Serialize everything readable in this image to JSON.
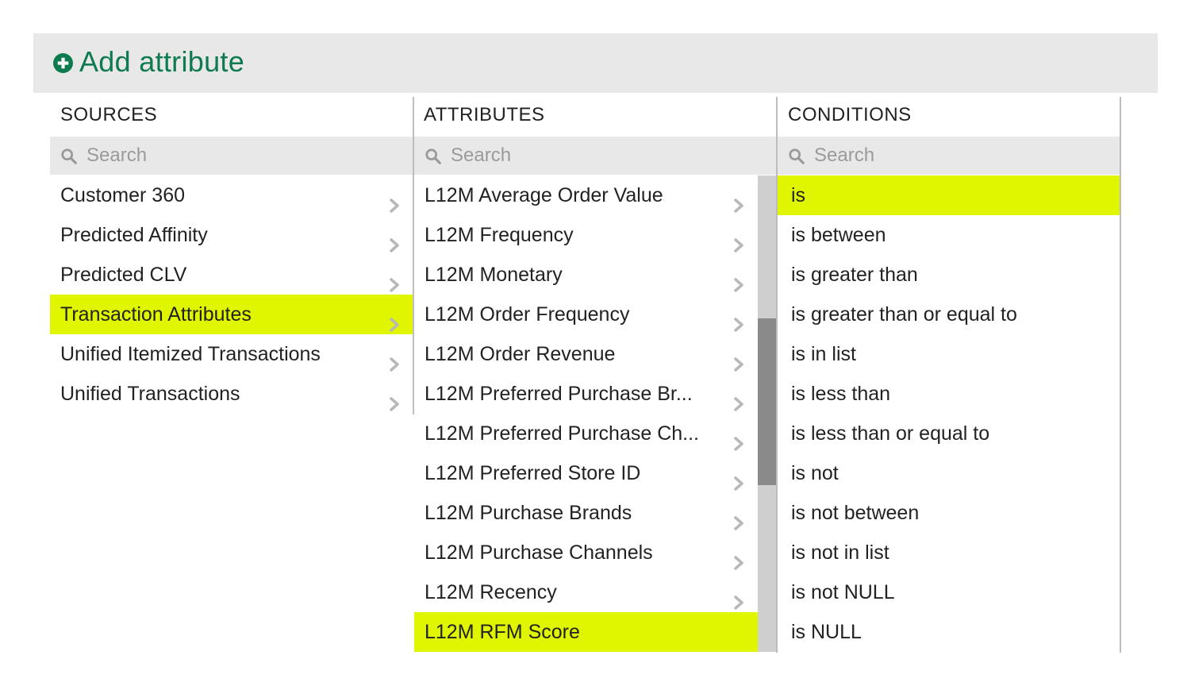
{
  "header": {
    "title": "Add attribute",
    "icon": "plus-circle-icon",
    "color": "#0e7a4f"
  },
  "highlight_color": "#e0f500",
  "columns": {
    "sources": {
      "title": "SOURCES",
      "search_placeholder": "Search",
      "items": [
        {
          "label": "Customer 360",
          "selected": false
        },
        {
          "label": "Predicted Affinity",
          "selected": false
        },
        {
          "label": "Predicted CLV",
          "selected": false
        },
        {
          "label": "Transaction Attributes",
          "selected": true
        },
        {
          "label": "Unified Itemized Transactions",
          "selected": false
        },
        {
          "label": "Unified Transactions",
          "selected": false
        }
      ]
    },
    "attributes": {
      "title": "ATTRIBUTES",
      "search_placeholder": "Search",
      "items": [
        {
          "label": "L12M Average Order Value",
          "selected": false,
          "chevron": true
        },
        {
          "label": "L12M Frequency",
          "selected": false,
          "chevron": true
        },
        {
          "label": "L12M Monetary",
          "selected": false,
          "chevron": true
        },
        {
          "label": "L12M Order Frequency",
          "selected": false,
          "chevron": true
        },
        {
          "label": "L12M Order Revenue",
          "selected": false,
          "chevron": true
        },
        {
          "label": "L12M Preferred Purchase Br...",
          "selected": false,
          "chevron": true
        },
        {
          "label": "L12M Preferred Purchase Ch...",
          "selected": false,
          "chevron": true
        },
        {
          "label": "L12M Preferred Store ID",
          "selected": false,
          "chevron": true
        },
        {
          "label": "L12M Purchase Brands",
          "selected": false,
          "chevron": true
        },
        {
          "label": "L12M Purchase Channels",
          "selected": false,
          "chevron": true
        },
        {
          "label": "L12M Recency",
          "selected": false,
          "chevron": true
        },
        {
          "label": "L12M RFM Score",
          "selected": true,
          "chevron": false
        }
      ],
      "scroll": {
        "position": 0.3,
        "visible_fraction": 0.35
      }
    },
    "conditions": {
      "title": "CONDITIONS",
      "search_placeholder": "Search",
      "items": [
        {
          "label": "is",
          "selected": true
        },
        {
          "label": "is between",
          "selected": false
        },
        {
          "label": "is greater than",
          "selected": false
        },
        {
          "label": "is greater than or equal to",
          "selected": false
        },
        {
          "label": "is in list",
          "selected": false
        },
        {
          "label": "is less than",
          "selected": false
        },
        {
          "label": "is less than or equal to",
          "selected": false
        },
        {
          "label": "is not",
          "selected": false
        },
        {
          "label": "is not between",
          "selected": false
        },
        {
          "label": "is not in list",
          "selected": false
        },
        {
          "label": "is not NULL",
          "selected": false
        },
        {
          "label": "is NULL",
          "selected": false
        }
      ]
    }
  }
}
